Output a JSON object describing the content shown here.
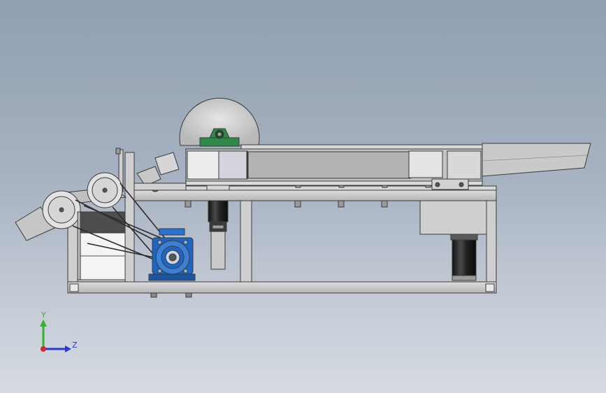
{
  "viewport": {
    "background_top": "#919fb0",
    "background_bottom": "#d6dbe2"
  },
  "model": {
    "frame_color": "#c9c9c9",
    "frame_edge": "#3a3a3a",
    "motor_color": "#1f6fd1",
    "bearing_color": "#2f8a4a",
    "panel_color": "#cfcfcf",
    "servo_color": "#2b2b2b"
  },
  "triad": {
    "y_label": "Y",
    "z_label": "Z",
    "y_color": "#2fb52f",
    "z_color": "#2a3ad8",
    "x_color": "#d22a2a"
  }
}
